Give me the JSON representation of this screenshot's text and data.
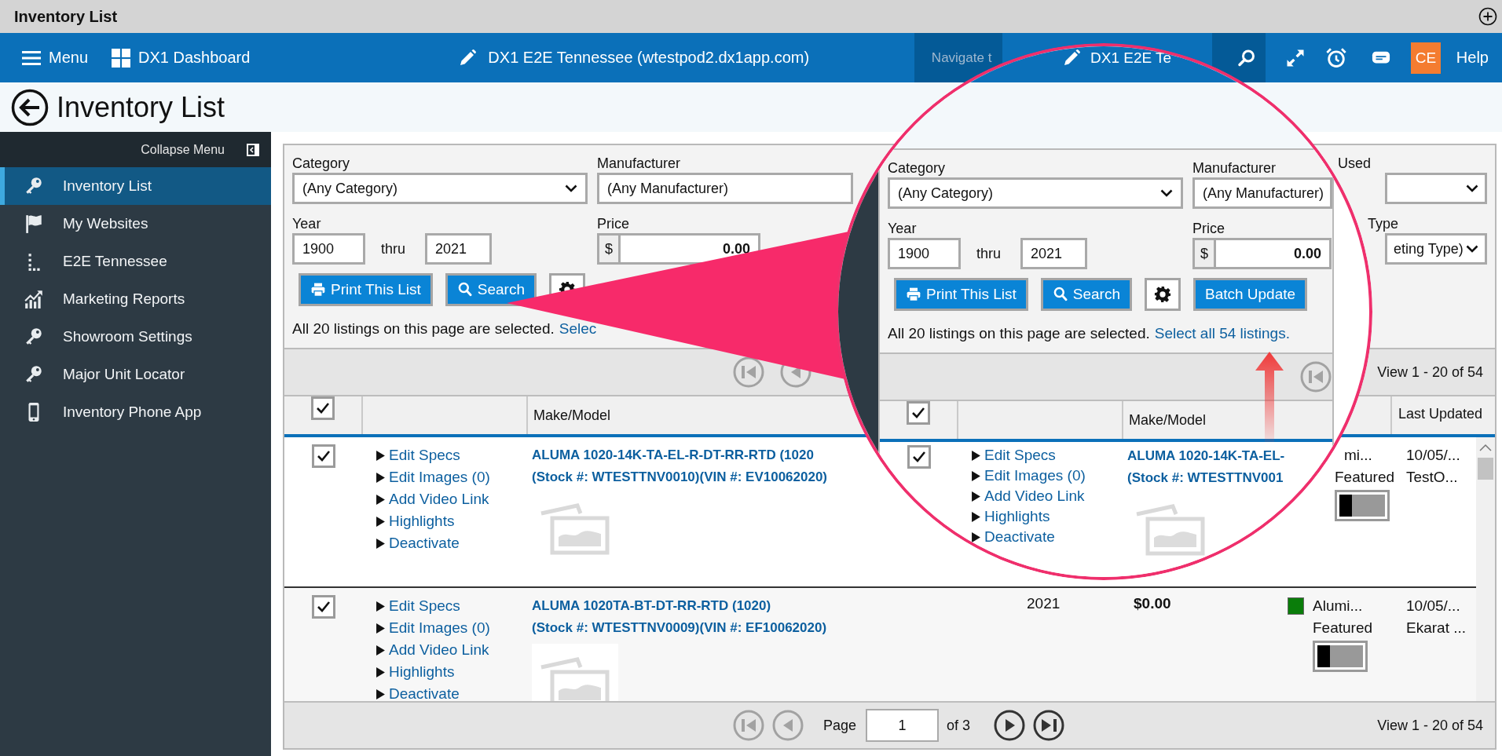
{
  "title_bar": {
    "title": "Inventory List"
  },
  "nav": {
    "menu": "Menu",
    "dashboard": "DX1 Dashboard",
    "site": "DX1 E2E Tennessee (wtestpod2.dx1app.com)",
    "search_placeholder": "Navigate t",
    "initials": "CE",
    "help": "Help"
  },
  "page_title": "Inventory List",
  "sidebar": {
    "collapse": "Collapse Menu",
    "items": [
      {
        "label": "Inventory List",
        "selected": true
      },
      {
        "label": "My Websites",
        "selected": false
      },
      {
        "label": "E2E Tennessee",
        "selected": false
      },
      {
        "label": "Marketing Reports",
        "selected": false
      },
      {
        "label": "Showroom Settings",
        "selected": false
      },
      {
        "label": "Major Unit Locator",
        "selected": false
      },
      {
        "label": "Inventory Phone App",
        "selected": false
      }
    ]
  },
  "filters": {
    "category_label": "Category",
    "category": "(Any Category)",
    "manufacturer_label": "Manufacturer",
    "manufacturer": "(Any Manufacturer)",
    "year_label": "Year",
    "year_from": "1900",
    "thru": "thru",
    "year_to": "2021",
    "price_label": "Price",
    "currency": "$",
    "price_min": "0.00",
    "used_label": "Used",
    "type_label": "Type",
    "marketing_type": "eting Type)",
    "buttons": [
      "Print This List",
      "Search"
    ],
    "selection_text": "All 20 listings on this page are selected.",
    "select_all_link": "Selec"
  },
  "top_pager": {
    "buttons": [
      {
        "kind": "first",
        "disabled": true
      },
      {
        "kind": "prev",
        "disabled": true
      }
    ],
    "view": "View 1 - 20 of 54"
  },
  "table": {
    "all_checked": true,
    "make_model_header": "Make/Model",
    "last_updated_header": "Last Updated",
    "rows": [
      {
        "checked": true,
        "actions": [
          "Edit Specs",
          "Edit Images (0)",
          "Add Video Link",
          "Highlights",
          "Deactivate"
        ],
        "make_model": "ALUMA 1020-14K-TA-EL-R-DT-RR-RTD (1020",
        "stock": "(Stock #: WTESTTNV0010)(VIN #: EV10062020)",
        "category": "mi...",
        "featured_label": "Featured",
        "featured": false,
        "updated": "10/05/...",
        "updated_by": "TestO..."
      },
      {
        "checked": true,
        "actions": [
          "Edit Specs",
          "Edit Images (0)",
          "Add Video Link",
          "Highlights",
          "Deactivate"
        ],
        "make_model": "ALUMA 1020TA-BT-DT-RR-RTD (1020)",
        "stock": "(Stock #: WTESTTNV0009)(VIN #: EF10062020)",
        "year": "2021",
        "price": "$0.00",
        "color": "#0a7d0a",
        "category": "Alumi...",
        "featured_label": "Featured",
        "featured": false,
        "updated": "10/05/...",
        "updated_by": "Ekarat ..."
      }
    ]
  },
  "bottom_pager": {
    "buttons": [
      {
        "kind": "first",
        "disabled": true
      },
      {
        "kind": "prev",
        "disabled": true
      }
    ],
    "page_label": "Page",
    "page": "1",
    "of": "of 3",
    "next_buttons": [
      {
        "kind": "next",
        "disabled": false
      },
      {
        "kind": "last",
        "disabled": false
      }
    ],
    "view": "View 1 - 20 of 54"
  },
  "magnifier": {
    "site": "DX1 E2E Te",
    "filters": {
      "category_label": "Category",
      "category": "(Any Category)",
      "manufacturer_label": "Manufacturer",
      "manufacturer": "(Any Manufacturer)",
      "year_label": "Year",
      "year_from": "1900",
      "thru": "thru",
      "year_to": "2021",
      "price_label": "Price",
      "currency": "$",
      "price_min": "0.00",
      "buttons": [
        "Print This List",
        "Search",
        "Batch Update"
      ],
      "selection_text": "All 20 listings on this page are selected.",
      "select_all_link": "Select all 54 listings."
    },
    "pager_buttons": [
      {
        "kind": "first",
        "disabled": true
      }
    ],
    "table": {
      "all_checked": true,
      "make_model_header": "Make/Model",
      "row": {
        "checked": true,
        "actions": [
          "Edit Specs",
          "Edit Images (0)",
          "Add Video Link",
          "Highlights",
          "Deactivate"
        ],
        "make_model": "ALUMA 1020-14K-TA-EL-",
        "stock": "(Stock #: WTESTTNV001"
      }
    }
  }
}
